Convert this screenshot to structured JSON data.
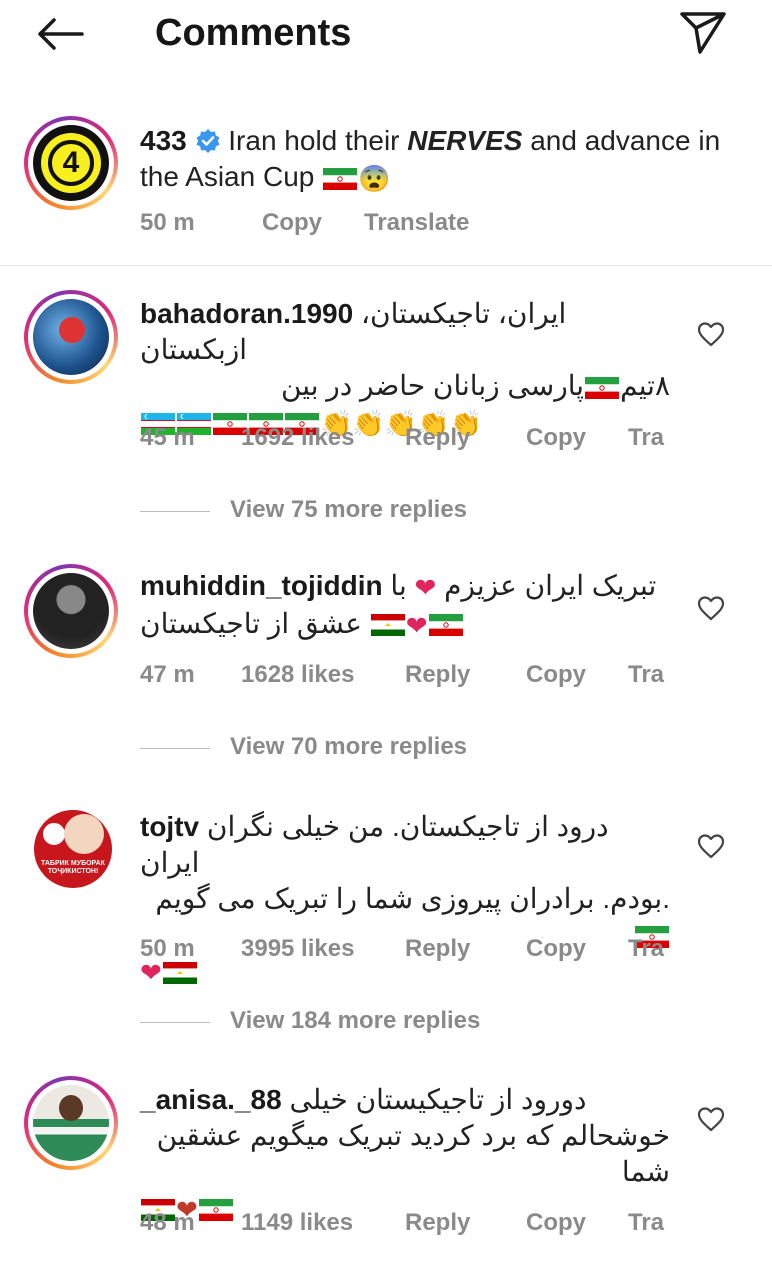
{
  "header": {
    "title": "Comments"
  },
  "caption": {
    "username": "433",
    "text_pre": "Iran hold their ",
    "text_bold": "NERVES",
    "text_post": " and advance in the Asian Cup",
    "emoji": "😨",
    "time": "50 m",
    "copy": "Copy",
    "translate": "Translate",
    "avatar_label": "4"
  },
  "comments": [
    {
      "username": "bahadoran.1990",
      "line1": "ایران، تاجیکستان، ازبکستان",
      "line2": "پارسی زبانان حاضر در بین",
      "line2b": "۸تیم",
      "time": "45 m",
      "likes": "1692 likes",
      "reply": "Reply",
      "copy": "Copy",
      "tra": "Tra",
      "view_replies": "View 75 more replies"
    },
    {
      "username": "muhiddin_tojiddin",
      "line1": "تبریک ایران عزیزم",
      "line1b": "با",
      "line2": "عشق از تاجیکستان",
      "time": "47 m",
      "likes": "1628 likes",
      "reply": "Reply",
      "copy": "Copy",
      "tra": "Tra",
      "view_replies": "View 70 more replies"
    },
    {
      "username": "tojtv",
      "line1": "درود از تاجیکستان.  من خیلی نگران ایران",
      "line2": ".بودم.  برادران پیروزی شما را تبریک می گویم",
      "time": "50 m",
      "likes": "3995 likes",
      "reply": "Reply",
      "copy": "Copy",
      "tra": "Tra",
      "view_replies": "View 184 more replies",
      "avatar_text": "ТАБРИК МУБОРАК ТОҶИКИСТОН!"
    },
    {
      "username": "_anisa._88",
      "line1": "دورود از تاجیکیستان خیلی",
      "line2": "خوشحالم که برد کردید تبریک میگویم عشقین شما",
      "time": "48 m",
      "likes": "1149 likes",
      "reply": "Reply",
      "copy": "Copy",
      "tra": "Tra"
    }
  ],
  "colors": {
    "verified": "#3897f0",
    "heart_emoji": "#e0245e",
    "meta": "#8a8a8a"
  },
  "icons": [
    "back-arrow-icon",
    "send-icon",
    "verified-icon",
    "heart-outline-icon",
    "clap-emoji",
    "iran-flag",
    "tajikistan-flag",
    "uzbekistan-flag"
  ]
}
